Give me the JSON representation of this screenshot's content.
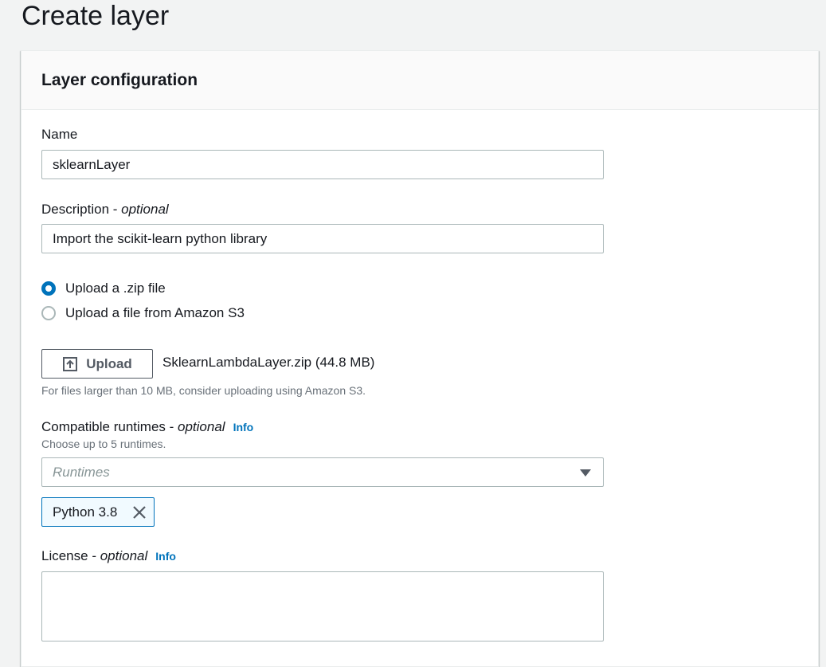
{
  "page": {
    "title": "Create layer"
  },
  "panel": {
    "title": "Layer configuration"
  },
  "name_field": {
    "label": "Name",
    "value": "sklearnLayer"
  },
  "description_field": {
    "label": "Description - ",
    "optional": "optional",
    "value": "Import the scikit-learn python library"
  },
  "upload_options": [
    {
      "label": "Upload a .zip file",
      "selected": true
    },
    {
      "label": "Upload a file from Amazon S3",
      "selected": false
    }
  ],
  "upload": {
    "button_label": "Upload",
    "file_name": "SklearnLambdaLayer.zip (44.8 MB)",
    "hint": "For files larger than 10 MB, consider uploading using Amazon S3."
  },
  "runtimes": {
    "label": "Compatible runtimes - ",
    "optional": "optional",
    "info": "Info",
    "hint": "Choose up to 5 runtimes.",
    "placeholder": "Runtimes",
    "selected": [
      "Python 3.8"
    ]
  },
  "license": {
    "label": "License - ",
    "optional": "optional",
    "info": "Info",
    "value": ""
  },
  "colors": {
    "accent": "#0073bb",
    "background": "#f2f3f3",
    "token_bg": "#f1faff"
  }
}
